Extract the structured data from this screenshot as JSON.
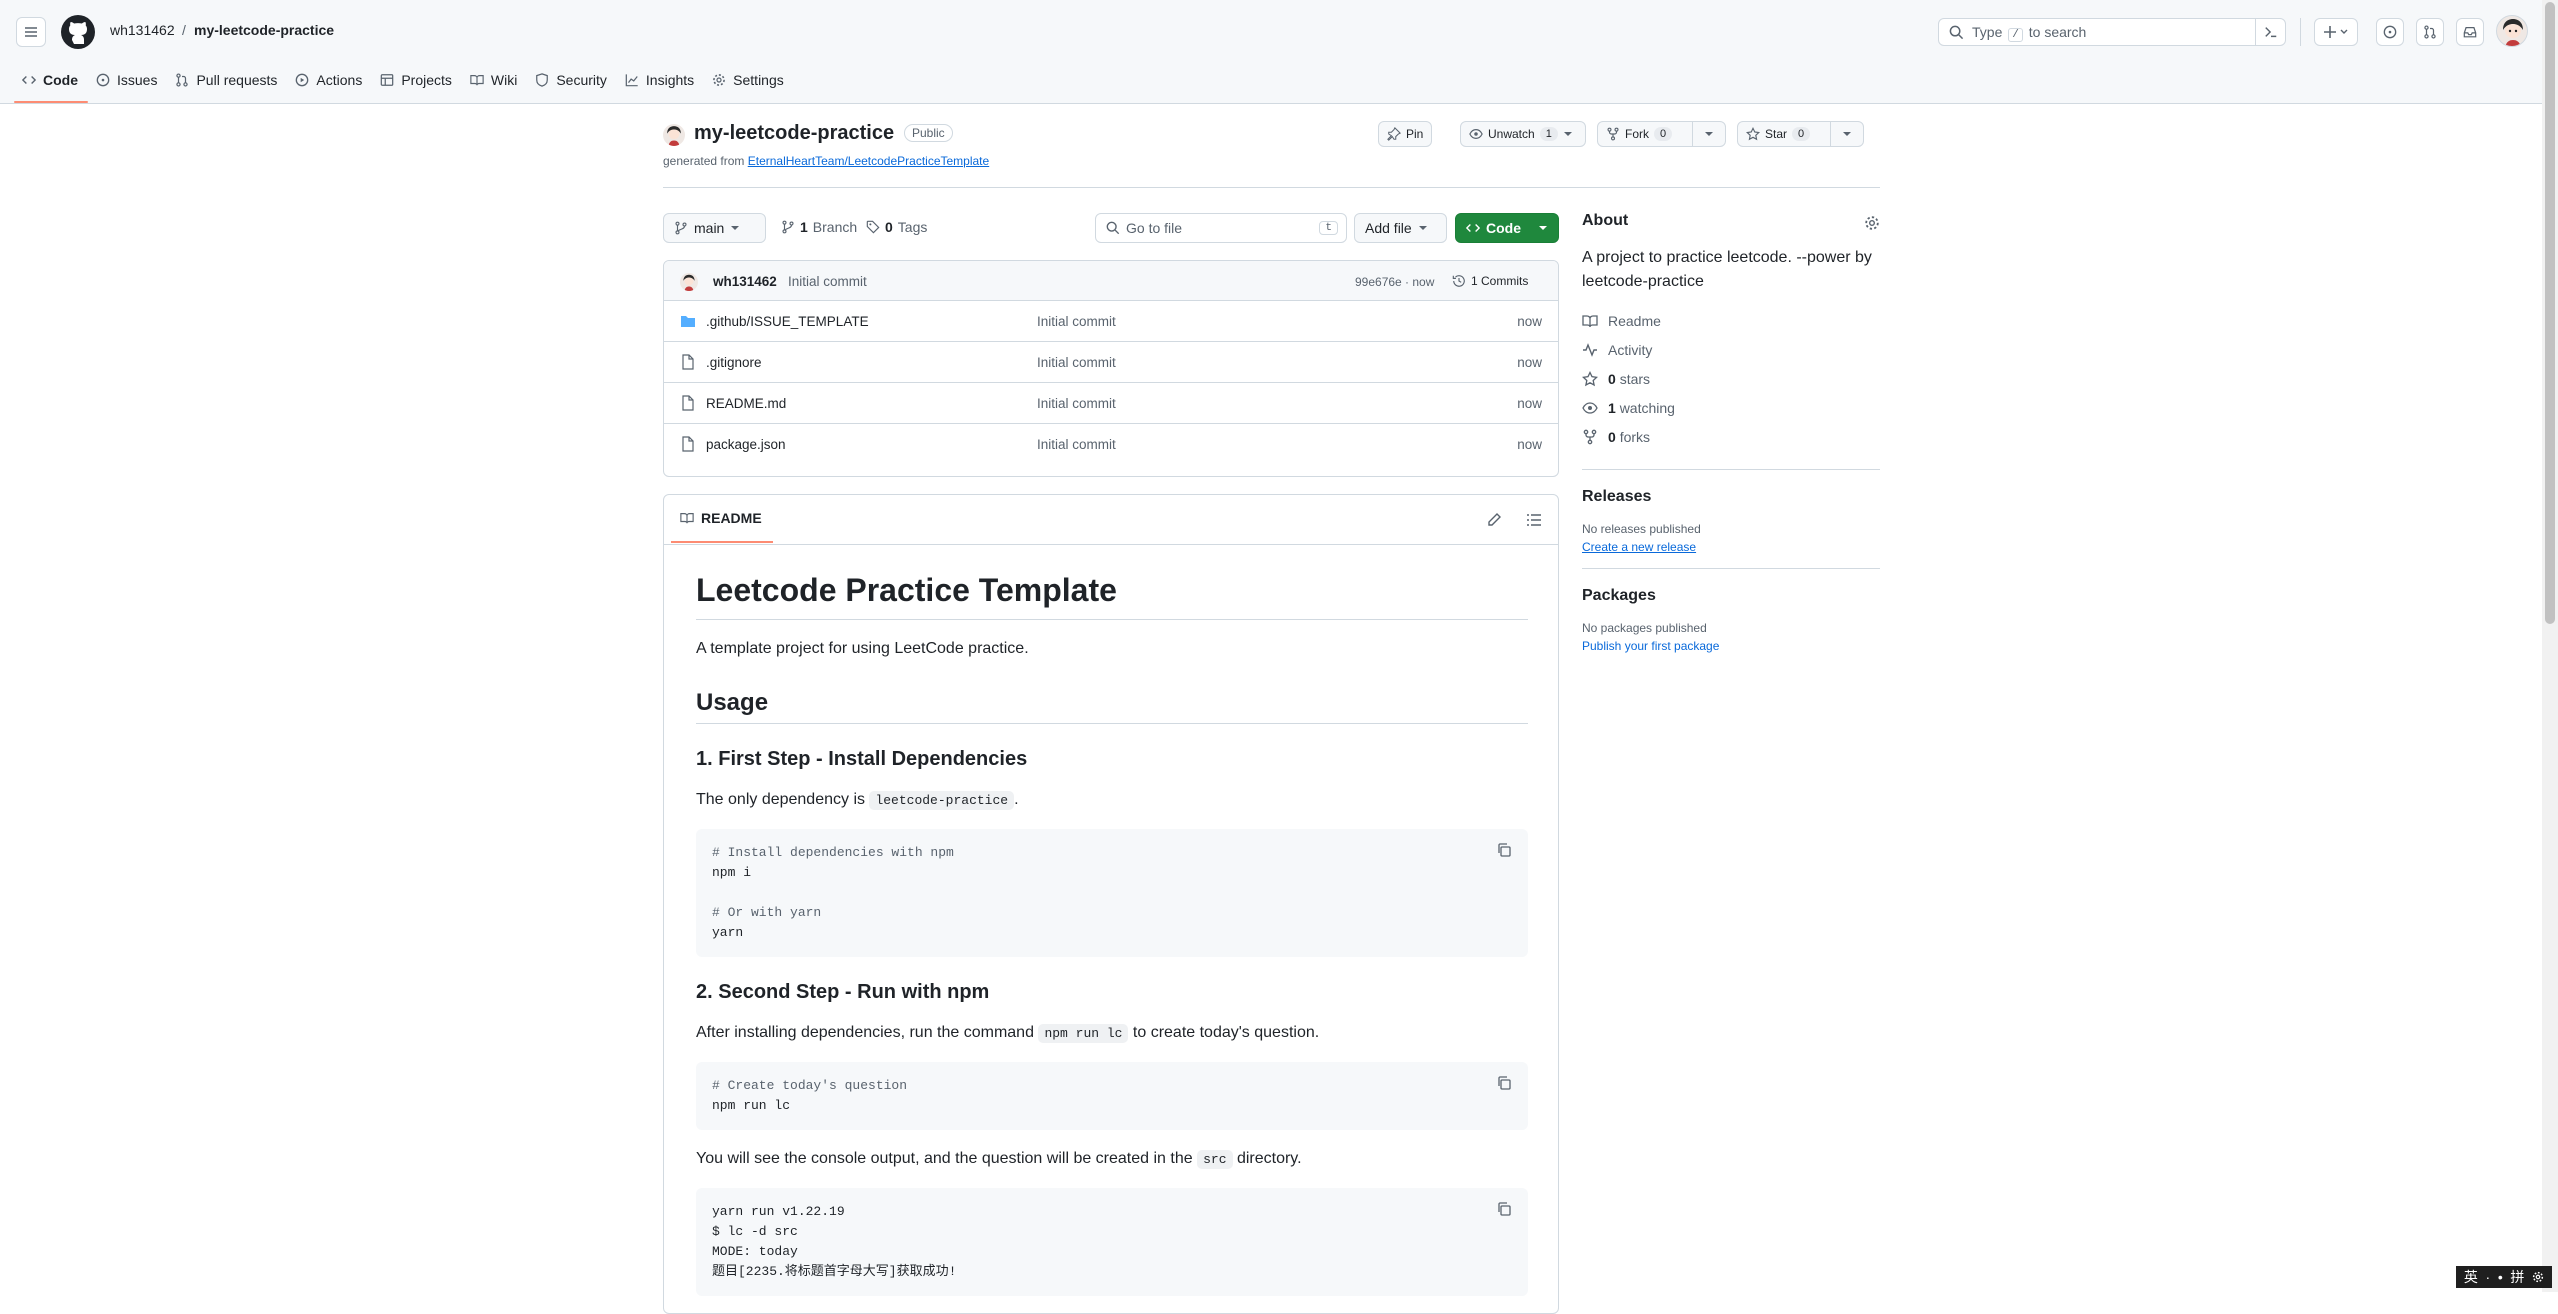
{
  "header": {
    "owner": "wh131462",
    "separator": "/",
    "repo": "my-leetcode-practice",
    "search_text_before": "Type",
    "search_kbd": "/",
    "search_text_after": "to search"
  },
  "nav_tabs": [
    {
      "label": "Code",
      "icon": "code-icon",
      "active": true
    },
    {
      "label": "Issues",
      "icon": "issue-icon"
    },
    {
      "label": "Pull requests",
      "icon": "pull-request-icon"
    },
    {
      "label": "Actions",
      "icon": "play-icon"
    },
    {
      "label": "Projects",
      "icon": "table-icon"
    },
    {
      "label": "Wiki",
      "icon": "book-icon"
    },
    {
      "label": "Security",
      "icon": "shield-icon"
    },
    {
      "label": "Insights",
      "icon": "graph-icon"
    },
    {
      "label": "Settings",
      "icon": "gear-icon"
    }
  ],
  "repo_header": {
    "name": "my-leetcode-practice",
    "visibility": "Public",
    "generated_prefix": "generated from",
    "generated_link": "EternalHeartTeam/LeetcodePracticeTemplate",
    "pin": "Pin",
    "unwatch": "Unwatch",
    "unwatch_count": "1",
    "fork": "Fork",
    "fork_count": "0",
    "star": "Star",
    "star_count": "0"
  },
  "toolbar": {
    "branch": "main",
    "branch_count": "1",
    "branch_label": "Branch",
    "tag_count": "0",
    "tag_label": "Tags",
    "goto_placeholder": "Go to file",
    "goto_kbd": "t",
    "add_file": "Add file",
    "code": "Code"
  },
  "commit": {
    "author": "wh131462",
    "message": "Initial commit",
    "hash_time": "99e676e · now",
    "commits": "1 Commits"
  },
  "files": [
    {
      "name": ".github/ISSUE_TEMPLATE",
      "type": "folder",
      "message": "Initial commit",
      "time": "now"
    },
    {
      "name": ".gitignore",
      "type": "file",
      "message": "Initial commit",
      "time": "now"
    },
    {
      "name": "README.md",
      "type": "file",
      "message": "Initial commit",
      "time": "now"
    },
    {
      "name": "package.json",
      "type": "file",
      "message": "Initial commit",
      "time": "now"
    }
  ],
  "readme": {
    "tab": "README",
    "title": "Leetcode Practice Template",
    "intro": "A template project for using LeetCode practice.",
    "usage": "Usage",
    "step1": "1. First Step - Install Dependencies",
    "dep_text": "The only dependency is",
    "dep_code": "leetcode-practice",
    "dep_end": ".",
    "code1_c1": "# Install dependencies with npm",
    "code1_l1": "npm i",
    "code1_c2": "# Or with yarn",
    "code1_l2": "yarn",
    "step2": "2. Second Step - Run with npm",
    "run_text1": "After installing dependencies, run the command",
    "run_code": "npm run lc",
    "run_text2": "to create today's question.",
    "code2_c1": "# Create today's question",
    "code2_l1": "npm run lc",
    "out_text1": "You will see the console output, and the question will be created in the",
    "out_code": "src",
    "out_text2": "directory.",
    "code3_l1": "yarn run v1.22.19",
    "code3_l2": "$ lc -d src",
    "code3_l3": "MODE: today",
    "code3_l4": "题目[2235.将标题首字母大写]获取成功!"
  },
  "about": {
    "title": "About",
    "desc": "A project to practice leetcode. --power by leetcode-practice",
    "readme": "Readme",
    "activity": "Activity",
    "stars_num": "0",
    "stars": "stars",
    "watch_num": "1",
    "watching": "watching",
    "forks_num": "0",
    "forks": "forks",
    "releases": "Releases",
    "no_releases": "No releases published",
    "create_release": "Create a new release",
    "packages": "Packages",
    "no_packages": "No packages published",
    "publish_package": "Publish your first package"
  },
  "ime": {
    "lang": "英",
    "punct": "·",
    "punct2": "•",
    "mode": "拼"
  },
  "colors": {
    "accent": "#fd8c73",
    "green": "#1f883d",
    "link": "#0969da",
    "folder": "#54aeff"
  }
}
